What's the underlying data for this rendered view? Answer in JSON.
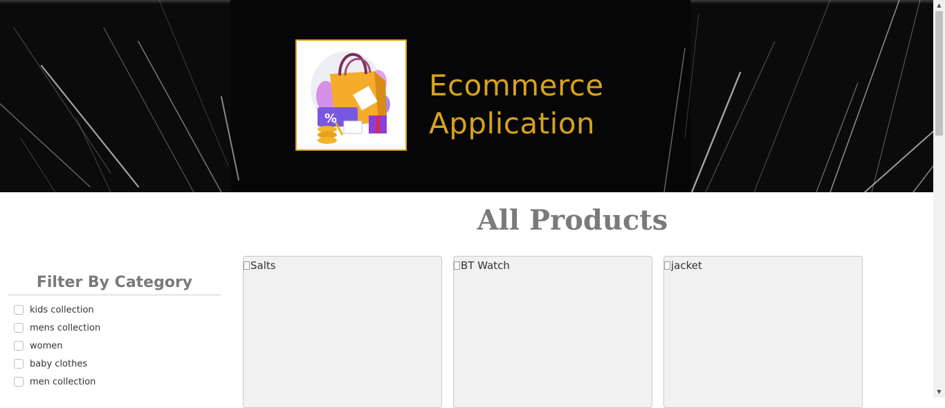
{
  "banner": {
    "brand_line1": "Ecommerce",
    "brand_line2": "Application",
    "brand_color": "#d8a31a",
    "logo_icon": "shopping-bag-icon"
  },
  "main": {
    "title": "All Products"
  },
  "filter": {
    "title": "Filter By Category",
    "categories": [
      {
        "label": "kids collection",
        "checked": false
      },
      {
        "label": "mens collection",
        "checked": false
      },
      {
        "label": "women",
        "checked": false
      },
      {
        "label": "baby clothes",
        "checked": false
      },
      {
        "label": "men collection",
        "checked": false
      }
    ]
  },
  "products": [
    {
      "image_alt": "Salts"
    },
    {
      "image_alt": "BT Watch"
    },
    {
      "image_alt": "jacket"
    }
  ]
}
